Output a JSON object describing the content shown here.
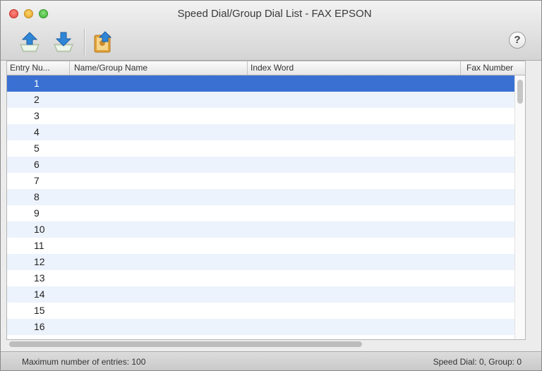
{
  "window": {
    "title": "Speed Dial/Group Dial List - FAX EPSON"
  },
  "toolbar": {
    "icons": [
      "import-icon",
      "export-icon",
      "edit-contacts-icon",
      "help-icon"
    ],
    "help_label": "?"
  },
  "table": {
    "columns": [
      "Entry Nu...",
      "Name/Group Name",
      "Index Word",
      "Fax Number"
    ],
    "rows": [
      {
        "entry": "1",
        "name": "",
        "index": "",
        "fax": ""
      },
      {
        "entry": "2",
        "name": "",
        "index": "",
        "fax": ""
      },
      {
        "entry": "3",
        "name": "",
        "index": "",
        "fax": ""
      },
      {
        "entry": "4",
        "name": "",
        "index": "",
        "fax": ""
      },
      {
        "entry": "5",
        "name": "",
        "index": "",
        "fax": ""
      },
      {
        "entry": "6",
        "name": "",
        "index": "",
        "fax": ""
      },
      {
        "entry": "7",
        "name": "",
        "index": "",
        "fax": ""
      },
      {
        "entry": "8",
        "name": "",
        "index": "",
        "fax": ""
      },
      {
        "entry": "9",
        "name": "",
        "index": "",
        "fax": ""
      },
      {
        "entry": "10",
        "name": "",
        "index": "",
        "fax": ""
      },
      {
        "entry": "11",
        "name": "",
        "index": "",
        "fax": ""
      },
      {
        "entry": "12",
        "name": "",
        "index": "",
        "fax": ""
      },
      {
        "entry": "13",
        "name": "",
        "index": "",
        "fax": ""
      },
      {
        "entry": "14",
        "name": "",
        "index": "",
        "fax": ""
      },
      {
        "entry": "15",
        "name": "",
        "index": "",
        "fax": ""
      },
      {
        "entry": "16",
        "name": "",
        "index": "",
        "fax": ""
      }
    ],
    "selected_entry": "1"
  },
  "status": {
    "left": "Maximum number of entries: 100",
    "right": "Speed Dial: 0, Group: 0"
  },
  "colors": {
    "selection": "#3a70d2",
    "stripe": "#edf3fd",
    "accent_blue": "#2f86d6"
  }
}
